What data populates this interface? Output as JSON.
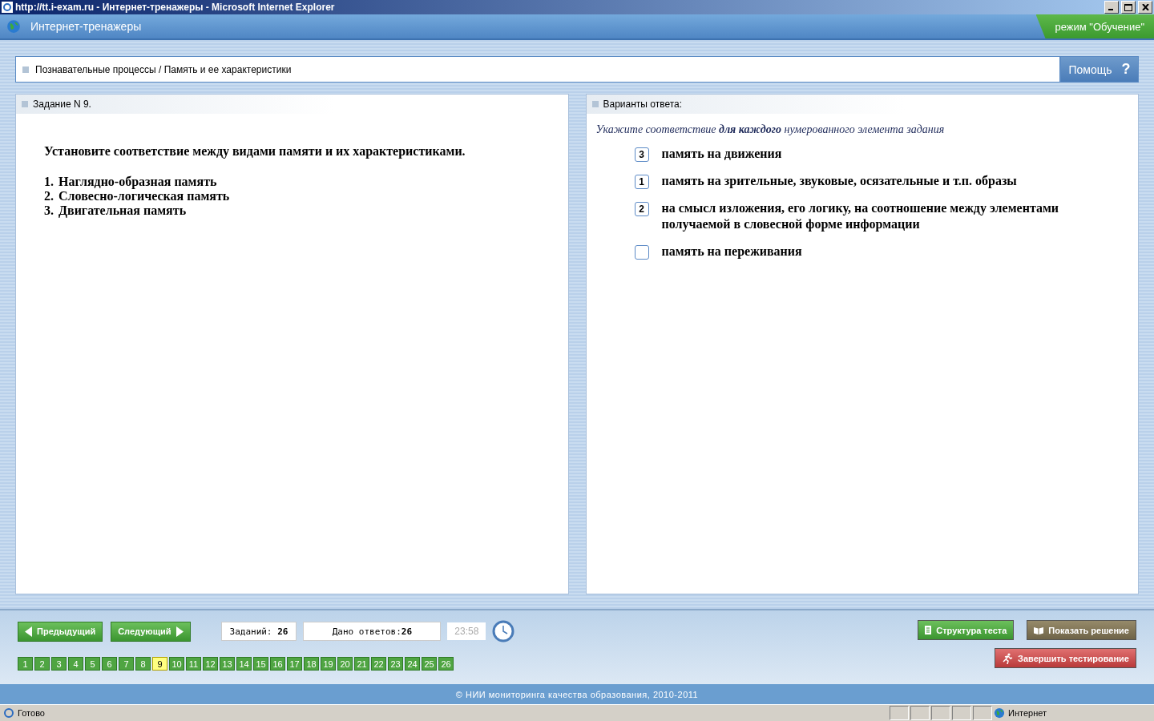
{
  "window": {
    "title": "http://tt.i-exam.ru - Интернет-тренажеры - Microsoft Internet Explorer"
  },
  "header": {
    "title": "Интернет-тренажеры",
    "mode": "режим \"Обучение\""
  },
  "breadcrumb": {
    "text": "Познавательные процессы / Память и ее характеристики",
    "help": "Помощь",
    "help_mark": "?"
  },
  "task": {
    "heading": "Задание N 9.",
    "question": "Установите соответствие между видами памяти и их характеристиками.",
    "items": [
      {
        "number": "1.",
        "text": "Наглядно-образная память"
      },
      {
        "number": "2.",
        "text": "Словесно-логическая память"
      },
      {
        "number": "3.",
        "text": "Двигательная память"
      }
    ]
  },
  "answers": {
    "heading": "Варианты ответа:",
    "instruction": "Укажите соответствие **для каждого** нумерованного элемента задания",
    "options": [
      {
        "answer": "3",
        "text": "память на движения"
      },
      {
        "answer": "1",
        "text": "память на зрительные, звуковые, осязательные и т.п. образы"
      },
      {
        "answer": "2",
        "text": "на смысл изложения, его логику, на соотношение между элементами получаемой в словесной форме информации"
      },
      {
        "text": "память на переживания"
      }
    ]
  },
  "footer": {
    "prev": "Предыдущий",
    "next": "Следующий",
    "tasks_label": "Заданий:",
    "tasks_count": "26",
    "answered_label": "Дано ответов:",
    "answered_count": "26",
    "timer": "23:58",
    "structure": "Структура теста",
    "show_solution": "Показать решение",
    "finish": "Завершить тестирование",
    "pages": [
      {
        "label": "1",
        "selected": false
      },
      {
        "label": "2",
        "selected": false
      },
      {
        "label": "3",
        "selected": false
      },
      {
        "label": "4",
        "selected": false
      },
      {
        "label": "5",
        "selected": false
      },
      {
        "label": "6",
        "selected": false
      },
      {
        "label": "7",
        "selected": false
      },
      {
        "label": "8",
        "selected": false
      },
      {
        "label": "9",
        "selected": true
      },
      {
        "label": "10",
        "selected": false
      },
      {
        "label": "11",
        "selected": false
      },
      {
        "label": "12",
        "selected": false
      },
      {
        "label": "13",
        "selected": false
      },
      {
        "label": "14",
        "selected": false
      },
      {
        "label": "15",
        "selected": false
      },
      {
        "label": "16",
        "selected": false
      },
      {
        "label": "17",
        "selected": false
      },
      {
        "label": "18",
        "selected": false
      },
      {
        "label": "19",
        "selected": false
      },
      {
        "label": "20",
        "selected": false
      },
      {
        "label": "21",
        "selected": false
      },
      {
        "label": "22",
        "selected": false
      },
      {
        "label": "23",
        "selected": false
      },
      {
        "label": "24",
        "selected": false
      },
      {
        "label": "25",
        "selected": false
      },
      {
        "label": "26",
        "selected": false
      }
    ]
  },
  "copyright": "© НИИ мониторинга качества образования, 2010-2011",
  "status_bar": {
    "text": "Готово",
    "zone": "Интернет"
  }
}
